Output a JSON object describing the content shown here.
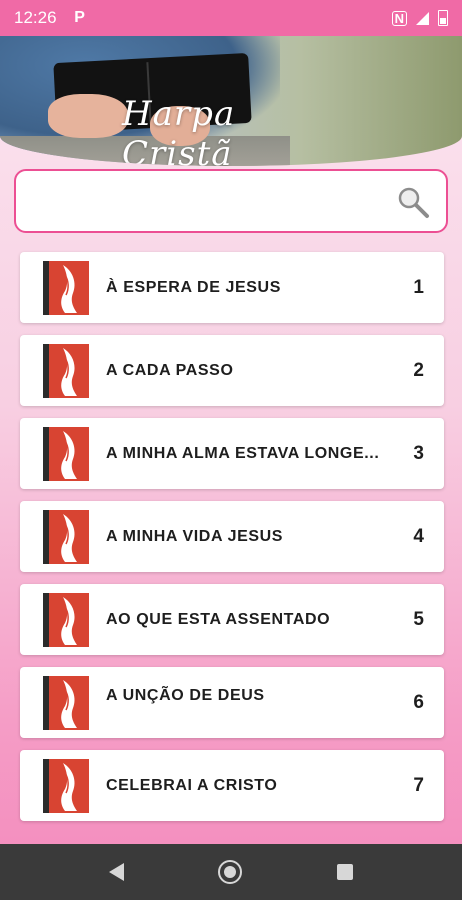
{
  "status_bar": {
    "time": "12:26",
    "app_letter": "P"
  },
  "header": {
    "title": "Harpa Cristã"
  },
  "search": {
    "placeholder": ""
  },
  "hymns": [
    {
      "title": "À ESPERA DE JESUS",
      "number": "1"
    },
    {
      "title": "A CADA PASSO",
      "number": "2"
    },
    {
      "title": "A MINHA ALMA ESTAVA LONGE...",
      "number": "3"
    },
    {
      "title": "A MINHA VIDA JESUS",
      "number": "4"
    },
    {
      "title": "AO QUE ESTA ASSENTADO",
      "number": "5"
    },
    {
      "title": "A UNÇÃO DE DEUS",
      "number": "6"
    },
    {
      "title": "CELEBRAI A CRISTO",
      "number": "7"
    }
  ],
  "colors": {
    "accent": "#ec4f93",
    "status_bar": "#f06aa6",
    "icon_red": "#d84432",
    "nav_bar": "#3a3a3a"
  },
  "icons": {
    "search": "magnifier-icon",
    "hymn": "harp-book-icon"
  }
}
